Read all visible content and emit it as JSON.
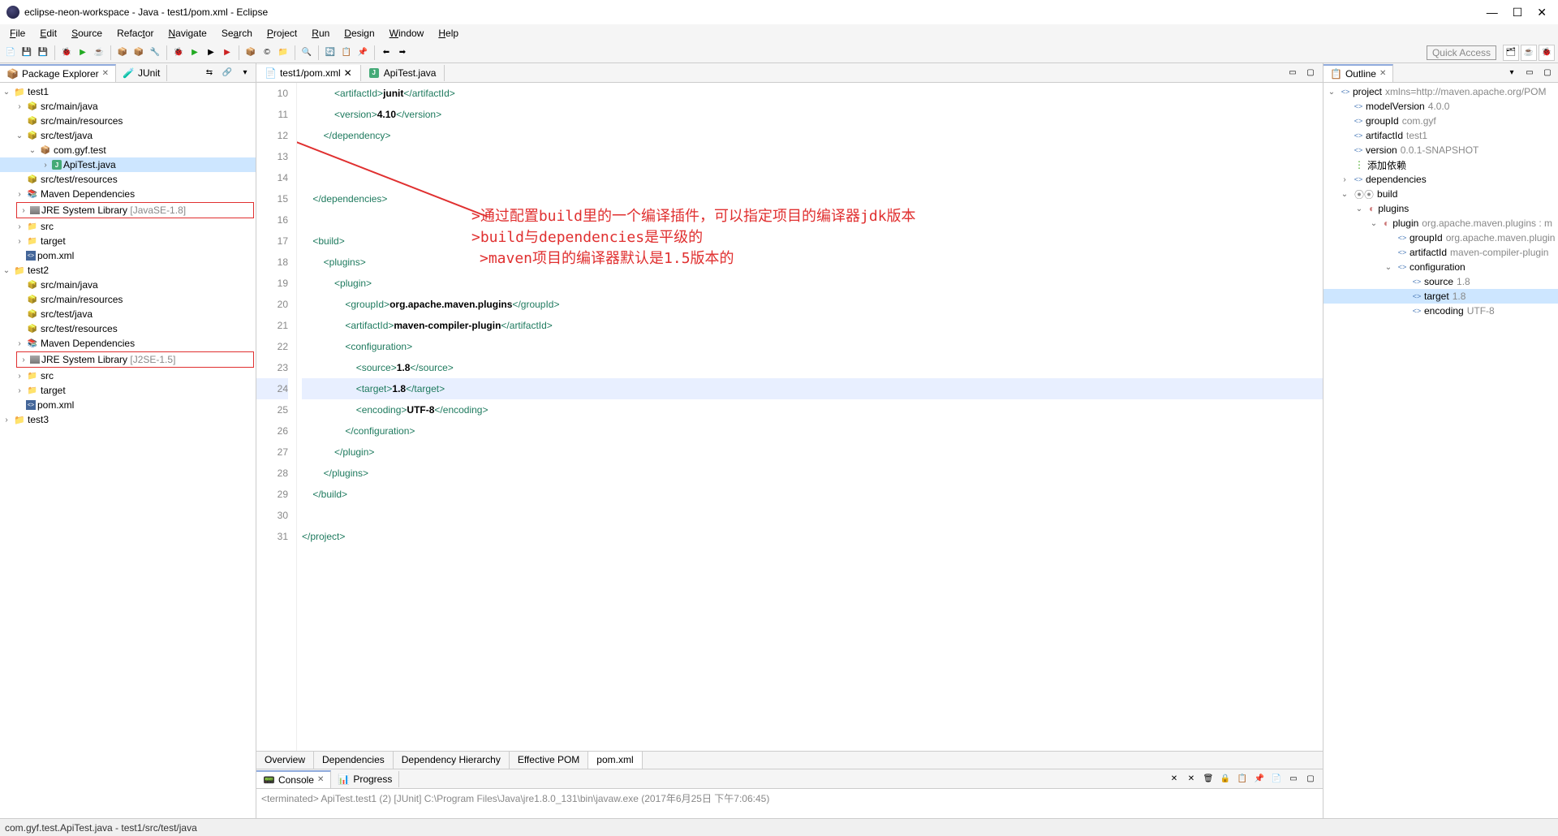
{
  "title": "eclipse-neon-workspace - Java - test1/pom.xml - Eclipse",
  "menu": [
    "File",
    "Edit",
    "Source",
    "Refactor",
    "Navigate",
    "Search",
    "Project",
    "Run",
    "Design",
    "Window",
    "Help"
  ],
  "quickaccess": "Quick Access",
  "leftTabs": [
    "Package Explorer",
    "JUnit"
  ],
  "tree": {
    "test1": {
      "items": [
        "src/main/java",
        "src/main/resources",
        "src/test/java",
        "src/test/resources",
        "Maven Dependencies"
      ],
      "pkg": "com.gyf.test",
      "file": "ApiTest.java",
      "jre": "JRE System Library",
      "jrev": "[JavaSE-1.8]",
      "rest": [
        "src",
        "target",
        "pom.xml"
      ]
    },
    "test2": {
      "items": [
        "src/main/java",
        "src/main/resources",
        "src/test/java",
        "src/test/resources",
        "Maven Dependencies"
      ],
      "jre": "JRE System Library",
      "jrev": "[J2SE-1.5]",
      "rest": [
        "src",
        "target",
        "pom.xml"
      ]
    },
    "test3": "test3"
  },
  "editorTabs": [
    "test1/pom.xml",
    "ApiTest.java"
  ],
  "lines": [
    10,
    11,
    12,
    13,
    14,
    15,
    16,
    17,
    18,
    19,
    20,
    21,
    22,
    23,
    24,
    25,
    26,
    27,
    28,
    29,
    30,
    31
  ],
  "code": {
    "l10a": "<artifactId>",
    "l10b": "junit",
    "l10c": "</artifactId>",
    "l11a": "<version>",
    "l11b": "4.10",
    "l11c": "</version>",
    "l12": "</dependency>",
    "l15": "</dependencies>",
    "l17": "<build>",
    "l18": "<plugins>",
    "l19": "<plugin>",
    "l20a": "<groupId>",
    "l20b": "org.apache.maven.plugins",
    "l20c": "</groupId>",
    "l21a": "<artifactId>",
    "l21b": "maven-compiler-plugin",
    "l21c": "</artifactId>",
    "l22": "<configuration>",
    "l23a": "<source>",
    "l23b": "1.8",
    "l23c": "</source>",
    "l24a": "<target>",
    "l24b": "1.8",
    "l24c": "</target>",
    "l25a": "<encoding>",
    "l25b": "UTF-8",
    "l25c": "</encoding>",
    "l26": "</configuration>",
    "l27": "</plugin>",
    "l28": "</plugins>",
    "l29": "</build>",
    "l31": "</project>"
  },
  "annotations": {
    "a1": ">通过配置build里的一个编译插件，可以指定项目的编译器jdk版本",
    "a2": ">build与dependencies是平级的",
    "a3": ">maven项目的编译器默认是1.5版本的"
  },
  "bottomTabs": [
    "Overview",
    "Dependencies",
    "Dependency Hierarchy",
    "Effective POM",
    "pom.xml"
  ],
  "consoleTabs": [
    "Console",
    "Progress"
  ],
  "consoleMsg": "<terminated> ApiTest.test1 (2) [JUnit] C:\\Program Files\\Java\\jre1.8.0_131\\bin\\javaw.exe (2017年6月25日 下午7:06:45)",
  "outlineTab": "Outline",
  "outline": {
    "root": {
      "k": "project",
      "v": "xmlns=http://maven.apache.org/POM"
    },
    "c1": [
      {
        "k": "modelVersion",
        "v": "4.0.0"
      },
      {
        "k": "groupId",
        "v": "com.gyf"
      },
      {
        "k": "artifactId",
        "v": "test1"
      },
      {
        "k": "version",
        "v": "0.0.1-SNAPSHOT"
      }
    ],
    "addDep": "添加依赖",
    "deps": "dependencies",
    "build": "build",
    "plugins": "plugins",
    "plugin": {
      "k": "plugin",
      "v": "org.apache.maven.plugins : m"
    },
    "pluginc": [
      {
        "k": "groupId",
        "v": "org.apache.maven.plugin"
      },
      {
        "k": "artifactId",
        "v": "maven-compiler-plugin"
      }
    ],
    "config": "configuration",
    "configc": [
      {
        "k": "source",
        "v": "1.8"
      },
      {
        "k": "target",
        "v": "1.8"
      },
      {
        "k": "encoding",
        "v": "UTF-8"
      }
    ]
  },
  "status": "com.gyf.test.ApiTest.java - test1/src/test/java"
}
